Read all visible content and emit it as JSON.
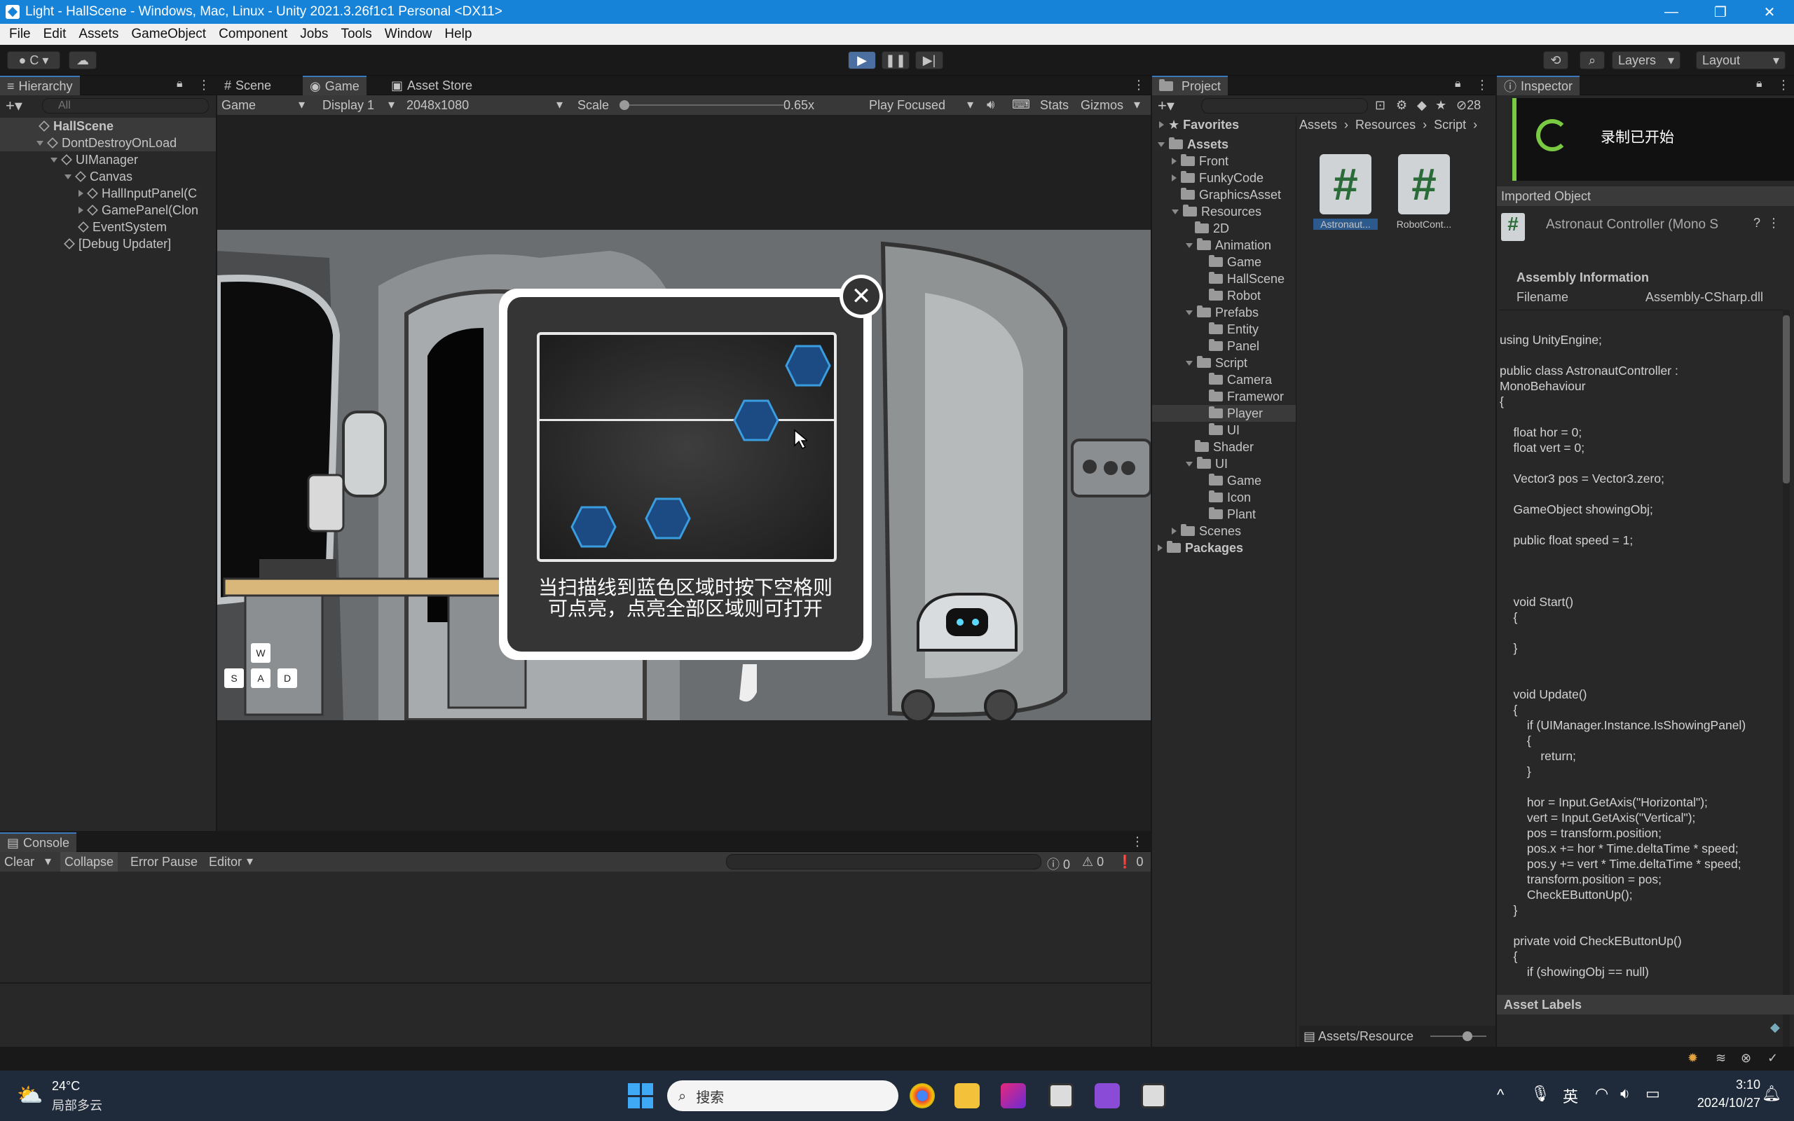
{
  "window": {
    "title": "Light - HallScene - Windows, Mac, Linux - Unity 2021.3.26f1c1 Personal <DX11>",
    "min": "—",
    "max": "❐",
    "close": "✕"
  },
  "menu": [
    "File",
    "Edit",
    "Assets",
    "GameObject",
    "Component",
    "Jobs",
    "Tools",
    "Window",
    "Help"
  ],
  "toolbar": {
    "account": "C ▾",
    "layers": "Layers",
    "layout": "Layout"
  },
  "hierarchy": {
    "tab": "Hierarchy",
    "search_placeholder": "All",
    "items": [
      {
        "label": "HallScene",
        "depth": 0
      },
      {
        "label": "DontDestroyOnLoad",
        "depth": 0
      },
      {
        "label": "UIManager",
        "depth": 1
      },
      {
        "label": "Canvas",
        "depth": 2
      },
      {
        "label": "HallInputPanel(C",
        "depth": 3
      },
      {
        "label": "GamePanel(Clon",
        "depth": 3
      },
      {
        "label": "EventSystem",
        "depth": 2
      },
      {
        "label": "[Debug Updater]",
        "depth": 1
      }
    ]
  },
  "gameview": {
    "tabs": [
      "Scene",
      "Game",
      "Asset Store"
    ],
    "display_mode": "Game",
    "display": "Display 1",
    "resolution": "2048x1080",
    "scale_label": "Scale",
    "scale_value": "0.65x",
    "play_focused": "Play Focused",
    "stats": "Stats",
    "gizmos": "Gizmos"
  },
  "game": {
    "panel_text": "当扫描线到蓝色区域时按下空格则\n可点亮，点亮全部区域则可打开",
    "keys": [
      "W",
      "S",
      "A",
      "D"
    ]
  },
  "project": {
    "tab": "Project",
    "count": "28",
    "favorites": "Favorites",
    "tree": [
      {
        "label": "Assets",
        "depth": 0
      },
      {
        "label": "Front",
        "depth": 1
      },
      {
        "label": "FunkyCode",
        "depth": 1
      },
      {
        "label": "GraphicsAsset",
        "depth": 1
      },
      {
        "label": "Resources",
        "depth": 1
      },
      {
        "label": "2D",
        "depth": 2
      },
      {
        "label": "Animation",
        "depth": 2
      },
      {
        "label": "Game",
        "depth": 3
      },
      {
        "label": "HallScene",
        "depth": 3
      },
      {
        "label": "Robot",
        "depth": 3
      },
      {
        "label": "Prefabs",
        "depth": 2
      },
      {
        "label": "Entity",
        "depth": 3
      },
      {
        "label": "Panel",
        "depth": 3
      },
      {
        "label": "Script",
        "depth": 2
      },
      {
        "label": "Camera",
        "depth": 3
      },
      {
        "label": "Framewor",
        "depth": 3
      },
      {
        "label": "Player",
        "depth": 3
      },
      {
        "label": "UI",
        "depth": 3
      },
      {
        "label": "Shader",
        "depth": 2
      },
      {
        "label": "UI",
        "depth": 2
      },
      {
        "label": "Game",
        "depth": 3
      },
      {
        "label": "Icon",
        "depth": 3
      },
      {
        "label": "Plant",
        "depth": 3
      },
      {
        "label": "Scenes",
        "depth": 1
      },
      {
        "label": "Packages",
        "depth": 0
      }
    ],
    "breadcrumb": [
      "Assets",
      "Resources",
      "Script"
    ],
    "assets": [
      "Astronaut...",
      "RobotCont..."
    ],
    "footer_path": "Assets/Resource"
  },
  "inspector": {
    "tab": "Inspector",
    "record_notice": "录制已开始",
    "imported_object": "Imported Object",
    "object_name": "Astronaut Controller (Mono S",
    "assembly_info": "Assembly Information",
    "filename_label": "Filename",
    "filename_value": "Assembly-CSharp.dll",
    "code": "using UnityEngine;\n\npublic class AstronautController :\nMonoBehaviour\n{\n\n    float hor = 0;\n    float vert = 0;\n\n    Vector3 pos = Vector3.zero;\n\n    GameObject showingObj;\n\n    public float speed = 1;\n\n\n\n    void Start()\n    {\n\n    }\n\n\n    void Update()\n    {\n        if (UIManager.Instance.IsShowingPanel)\n        {\n            return;\n        }\n\n        hor = Input.GetAxis(\"Horizontal\");\n        vert = Input.GetAxis(\"Vertical\");\n        pos = transform.position;\n        pos.x += hor * Time.deltaTime * speed;\n        pos.y += vert * Time.deltaTime * speed;\n        transform.position = pos;\n        CheckEButtonUp();\n    }\n\n    private void CheckEButtonUp()\n    {\n        if (showingObj == null)",
    "asset_labels": "Asset Labels"
  },
  "console": {
    "tab": "Console",
    "clear": "Clear",
    "collapse": "Collapse",
    "error_pause": "Error Pause",
    "editor": "Editor",
    "counts": [
      "0",
      "0",
      "0"
    ]
  },
  "taskbar": {
    "temp": "24°C",
    "weather": "局部多云",
    "search": "搜索",
    "ime": "英",
    "time": "3:10",
    "date": "2024/10/27"
  }
}
